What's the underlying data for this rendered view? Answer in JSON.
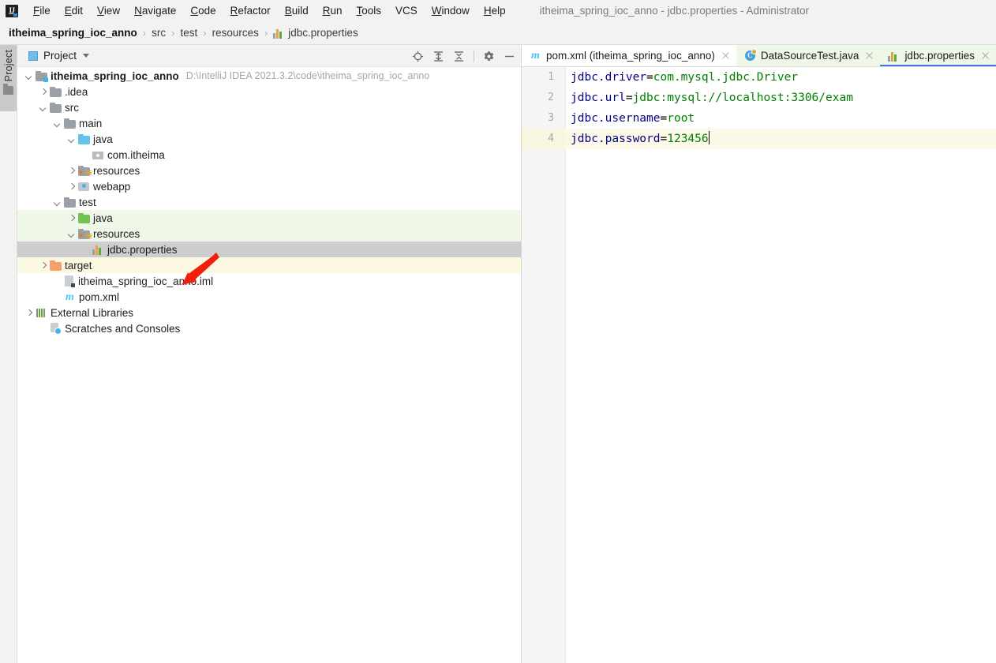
{
  "window": {
    "title": "itheima_spring_ioc_anno - jdbc.properties - Administrator",
    "logo_text": "IJ"
  },
  "menubar": {
    "items": [
      {
        "label": "File",
        "mnemonic": "F"
      },
      {
        "label": "Edit",
        "mnemonic": "E"
      },
      {
        "label": "View",
        "mnemonic": "V"
      },
      {
        "label": "Navigate",
        "mnemonic": "N"
      },
      {
        "label": "Code",
        "mnemonic": "C"
      },
      {
        "label": "Refactor",
        "mnemonic": "R"
      },
      {
        "label": "Build",
        "mnemonic": "B"
      },
      {
        "label": "Run",
        "mnemonic": "R"
      },
      {
        "label": "Tools",
        "mnemonic": "T"
      },
      {
        "label": "VCS",
        "mnemonic": ""
      },
      {
        "label": "Window",
        "mnemonic": "W"
      },
      {
        "label": "Help",
        "mnemonic": "H"
      }
    ]
  },
  "breadcrumb": {
    "separator": "›",
    "items": [
      {
        "label": "itheima_spring_ioc_anno",
        "icon": "none"
      },
      {
        "label": "src",
        "icon": "none"
      },
      {
        "label": "test",
        "icon": "none"
      },
      {
        "label": "resources",
        "icon": "none"
      },
      {
        "label": "jdbc.properties",
        "icon": "properties-file-icon"
      }
    ]
  },
  "toolstrip": {
    "project_label": "Project",
    "icon": "folder-icon"
  },
  "project_panel": {
    "title": "Project",
    "tools": [
      {
        "name": "locate-in-tree-icon",
        "tooltip": "Select Opened File"
      },
      {
        "name": "expand-all-icon",
        "tooltip": "Expand All"
      },
      {
        "name": "collapse-all-icon",
        "tooltip": "Collapse All"
      },
      {
        "name": "gear-icon",
        "tooltip": "Options"
      },
      {
        "name": "hide-icon",
        "tooltip": "Hide"
      }
    ],
    "tree": [
      {
        "label": "itheima_spring_ioc_anno",
        "path": "D:\\IntelliJ IDEA 2021.3.2\\code\\itheima_spring_ioc_anno",
        "indent": 0,
        "arrow": "down",
        "icon": "module-folder-icon",
        "bold": true,
        "row": "normal"
      },
      {
        "label": ".idea",
        "path": "",
        "indent": 1,
        "arrow": "right",
        "icon": "folder-gray-icon",
        "bold": false,
        "row": "normal"
      },
      {
        "label": "src",
        "path": "",
        "indent": 1,
        "arrow": "down",
        "icon": "folder-gray-icon",
        "bold": false,
        "row": "normal"
      },
      {
        "label": "main",
        "path": "",
        "indent": 2,
        "arrow": "down",
        "icon": "folder-gray-icon",
        "bold": false,
        "row": "normal"
      },
      {
        "label": "java",
        "path": "",
        "indent": 3,
        "arrow": "down",
        "icon": "folder-blue-icon",
        "bold": false,
        "row": "normal"
      },
      {
        "label": "com.itheima",
        "path": "",
        "indent": 4,
        "arrow": "none",
        "icon": "package-icon",
        "bold": false,
        "row": "normal"
      },
      {
        "label": "resources",
        "path": "",
        "indent": 3,
        "arrow": "right",
        "icon": "resources-folder-icon",
        "bold": false,
        "row": "normal"
      },
      {
        "label": "webapp",
        "path": "",
        "indent": 3,
        "arrow": "right",
        "icon": "webapp-folder-icon",
        "bold": false,
        "row": "normal"
      },
      {
        "label": "test",
        "path": "",
        "indent": 2,
        "arrow": "down",
        "icon": "folder-gray-icon",
        "bold": false,
        "row": "normal"
      },
      {
        "label": "java",
        "path": "",
        "indent": 3,
        "arrow": "right",
        "icon": "folder-green-icon",
        "bold": false,
        "row": "testsrc"
      },
      {
        "label": "resources",
        "path": "",
        "indent": 3,
        "arrow": "down",
        "icon": "resources-folder-icon",
        "bold": false,
        "row": "testsrc"
      },
      {
        "label": "jdbc.properties",
        "path": "",
        "indent": 4,
        "arrow": "none",
        "icon": "properties-file-icon",
        "bold": false,
        "row": "selected"
      },
      {
        "label": "target",
        "path": "",
        "indent": 1,
        "arrow": "right",
        "icon": "folder-orange-icon",
        "bold": false,
        "row": "target"
      },
      {
        "label": "itheima_spring_ioc_anno.iml",
        "path": "",
        "indent": 2,
        "arrow": "none",
        "icon": "iml-file-icon",
        "bold": false,
        "row": "normal"
      },
      {
        "label": "pom.xml",
        "path": "",
        "indent": 2,
        "arrow": "none",
        "icon": "maven-file-icon",
        "bold": false,
        "row": "normal"
      },
      {
        "label": "External Libraries",
        "path": "",
        "indent": 0,
        "arrow": "right",
        "icon": "external-libraries-icon",
        "bold": false,
        "row": "normal"
      },
      {
        "label": "Scratches and Consoles",
        "path": "",
        "indent": 1,
        "arrow": "none",
        "icon": "scratches-icon",
        "bold": false,
        "row": "normal"
      }
    ]
  },
  "editor": {
    "tabs": [
      {
        "label": "pom.xml (itheima_spring_ioc_anno)",
        "icon": "maven-file-icon",
        "state": "plain",
        "active": false
      },
      {
        "label": "DataSourceTest.java",
        "icon": "java-test-class-icon",
        "state": "tinted",
        "active": false
      },
      {
        "label": "jdbc.properties",
        "icon": "properties-file-icon",
        "state": "active",
        "active": true
      }
    ],
    "file_type": "properties",
    "current_line": 4,
    "lines": [
      {
        "number": "1",
        "key": "jdbc.driver",
        "sep": "=",
        "value": "com.mysql.jdbc.Driver",
        "caret": false
      },
      {
        "number": "2",
        "key": "jdbc.url",
        "sep": "=",
        "value": "jdbc:mysql://localhost:3306/exam",
        "caret": false
      },
      {
        "number": "3",
        "key": "jdbc.username",
        "sep": "=",
        "value": "root",
        "caret": false
      },
      {
        "number": "4",
        "key": "jdbc.password",
        "sep": "=",
        "value": "123456",
        "caret": true
      }
    ]
  },
  "annotations": {
    "highlight_box_color": "#f21f0e",
    "arrow_color": "#f21f0e",
    "arrow_target": "jdbc.properties"
  },
  "colors": {
    "key": "#000080",
    "value": "#008000",
    "current_line": "#fcf9e9",
    "selection": "#cdcdcd",
    "test_source_root": "#eef7e8",
    "excluded_target": "#fcf9e2",
    "tab_underline": "#3d7bd6"
  }
}
